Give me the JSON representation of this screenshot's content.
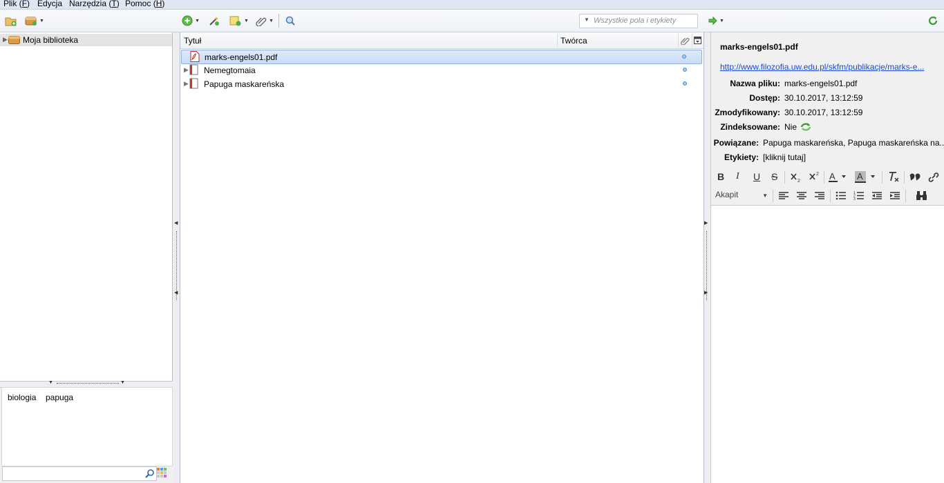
{
  "menu": [
    {
      "label": "Plik",
      "key": "F"
    },
    {
      "label": "Edycja",
      "key": ""
    },
    {
      "label": "Narzędzia",
      "key": "T"
    },
    {
      "label": "Pomoc",
      "key": "H"
    }
  ],
  "toolbar": {
    "search_placeholder": "Wszystkie pola i etykiety"
  },
  "sidebar": {
    "library_label": "Moja biblioteka"
  },
  "tags": [
    "biologia",
    "papuga"
  ],
  "items_table": {
    "columns": [
      "Tytuł",
      "Twórca"
    ],
    "rows": [
      {
        "title": "marks-engels01.pdf",
        "creator": "",
        "type": "pdf",
        "selected": true
      },
      {
        "title": "Nemegtomaia",
        "creator": "",
        "type": "book",
        "selected": false
      },
      {
        "title": "Papuga maskareńska",
        "creator": "",
        "type": "book",
        "selected": false
      }
    ]
  },
  "attachment": {
    "title": "marks-engels01.pdf",
    "url": "http://www.filozofia.uw.edu.pl/skfm/publikacje/marks-e...",
    "fields": [
      {
        "label": "Nazwa pliku:",
        "value": "marks-engels01.pdf"
      },
      {
        "label": "Dostęp:",
        "value": "30.10.2017, 13:12:59"
      },
      {
        "label": "Zmodyfikowany:",
        "value": "30.10.2017, 13:12:59"
      },
      {
        "label": "Zindeksowane:",
        "value": "Nie"
      },
      {
        "label": "Powiązane:",
        "value": "Papuga maskareńska, Papuga maskareńska na..."
      },
      {
        "label": "Etykiety:",
        "value": "[kliknij tutaj]"
      }
    ]
  },
  "editor": {
    "format_bold": "B",
    "format_italic": "I",
    "format_underline": "U",
    "format_strike": "S",
    "paragraph_select": "Akapit"
  },
  "colors": {
    "selection_bg": "#c9dbf5",
    "link": "#1a49d6",
    "menubar_bg": "#dfe6f4"
  }
}
